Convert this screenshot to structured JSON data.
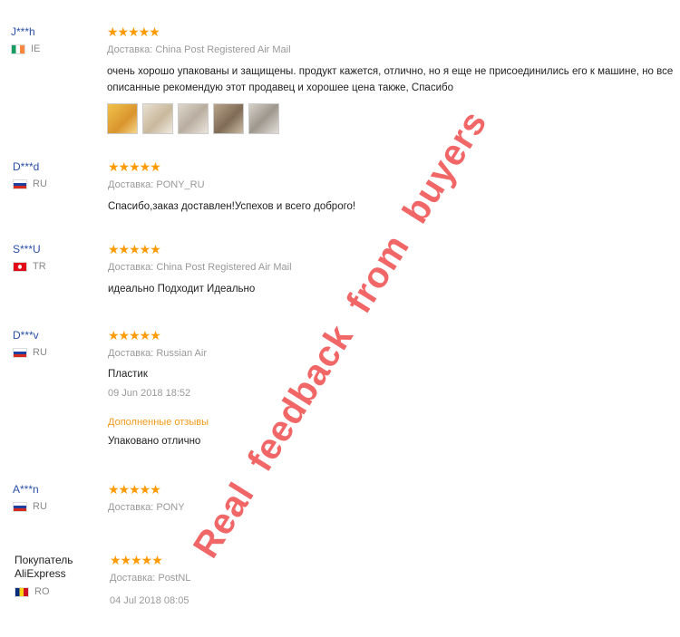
{
  "reviews": [
    {
      "buyer": "J***h",
      "country": "IE",
      "stars": "★★★★★",
      "delivery": "Доставка: China Post Registered Air Mail",
      "text": "очень хорошо упакованы и защищены. продукт кажется, отлично, но я еще не присоединились его к машине, но все описанные рекомендую этот продавец и хорошее цена также, Спасибо"
    },
    {
      "buyer": "D***d",
      "country": "RU",
      "stars": "★★★★★",
      "delivery": "Доставка: PONY_RU",
      "text": "Спасибо,заказ доставлен!Успехов и всего доброго!"
    },
    {
      "buyer": "S***U",
      "country": "TR",
      "stars": "★★★★★",
      "delivery": "Доставка: China Post Registered Air Mail",
      "text": "идеально Подходит Идеально"
    },
    {
      "buyer": "D***v",
      "country": "RU",
      "stars": "★★★★★",
      "delivery": "Доставка: Russian Air",
      "text": "Пластик",
      "date": "09 Jun 2018 18:52",
      "additional_label": "Дополненные отзывы",
      "additional_text": "Упаковано отлично"
    },
    {
      "buyer": "A***n",
      "country": "RU",
      "stars": "★★★★★",
      "delivery": "Доставка: PONY"
    },
    {
      "buyer_line1": "Покупатель",
      "buyer_line2": "AliExpress",
      "country": "RO",
      "stars": "★★★★★",
      "delivery": "Доставка: PostNL",
      "date": "04 Jul 2018 08:05"
    }
  ],
  "watermark": "Real  feedback  from  buyers"
}
